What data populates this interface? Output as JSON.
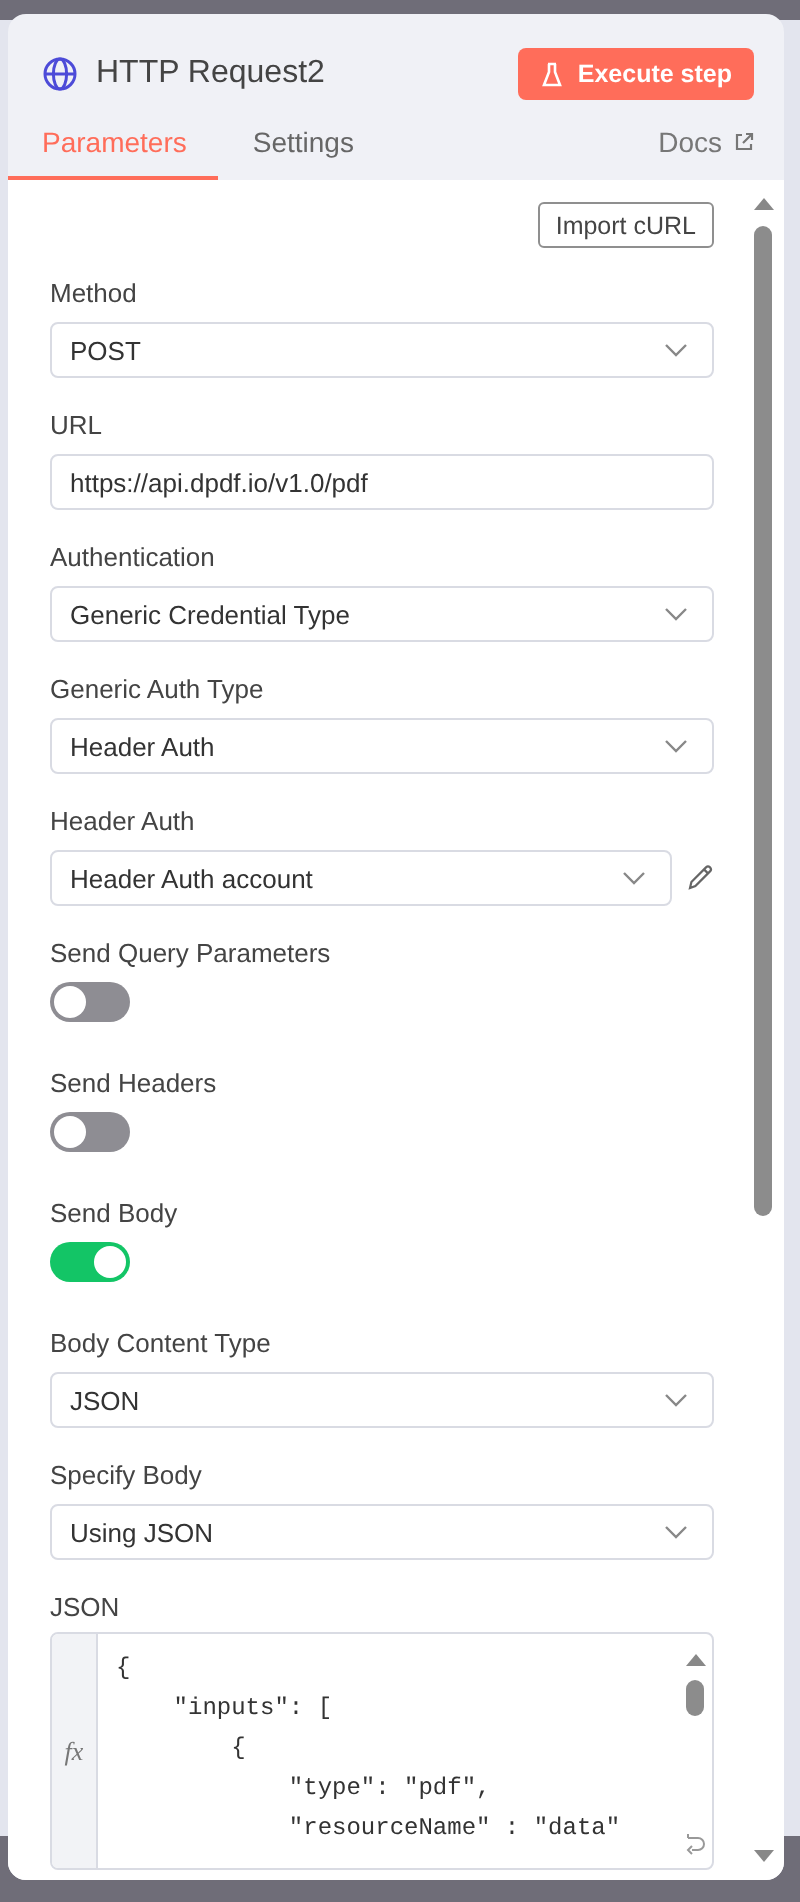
{
  "node": {
    "title": "HTTP Request2",
    "execute_label": "Execute step"
  },
  "tabs": [
    {
      "label": "Parameters",
      "selected": true
    },
    {
      "label": "Settings",
      "selected": false
    }
  ],
  "docs_link": "Docs",
  "import_button": "Import cURL",
  "fields": [
    {
      "kind": "select",
      "label": "Method",
      "value": "POST"
    },
    {
      "kind": "input",
      "label": "URL",
      "value": "https://api.dpdf.io/v1.0/pdf"
    },
    {
      "kind": "select",
      "label": "Authentication",
      "value": "Generic Credential Type"
    },
    {
      "kind": "select",
      "label": "Generic Auth Type",
      "value": "Header Auth"
    },
    {
      "kind": "credential",
      "label": "Header Auth",
      "value": "Header Auth account"
    },
    {
      "kind": "toggle",
      "label": "Send Query Parameters",
      "on": false
    },
    {
      "kind": "toggle",
      "label": "Send Headers",
      "on": false
    },
    {
      "kind": "toggle",
      "label": "Send Body",
      "on": true
    },
    {
      "kind": "select",
      "label": "Body Content Type",
      "value": "JSON"
    },
    {
      "kind": "select",
      "label": "Specify Body",
      "value": "Using JSON"
    },
    {
      "kind": "code",
      "label": "JSON",
      "gutter": "fx",
      "lines": [
        "{",
        "    \"inputs\": [",
        "        {",
        "            \"type\": \"pdf\",",
        "            \"resourceName\" : \"data\""
      ]
    }
  ]
}
